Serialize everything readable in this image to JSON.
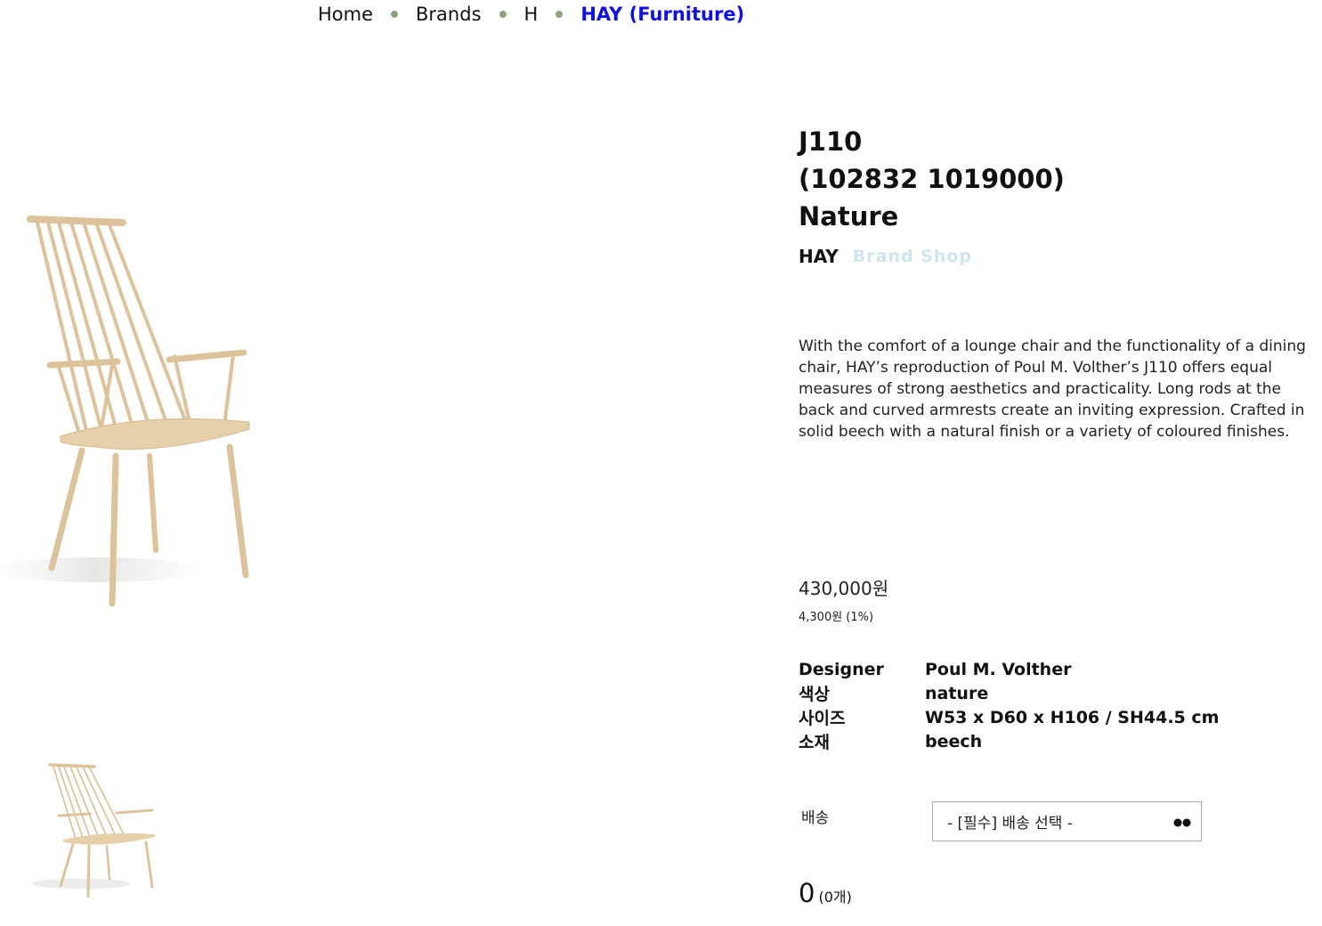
{
  "breadcrumb": {
    "items": [
      "Home",
      "Brands",
      "H"
    ],
    "current": "HAY (Furniture)"
  },
  "product": {
    "name_line1": "J110",
    "name_line2": "(102832 1019000)",
    "name_line3": "Nature",
    "brand": "HAY",
    "brand_shop_label": "Brand Shop",
    "description": "With the comfort of a lounge chair and the functionality of a dining chair, HAY’s reproduction of Poul M. Volther’s J110 offers equal measures of strong aesthetics and practicality. Long rods at the back and curved armrests create an inviting expression. Crafted in solid beech with a natural finish or a variety of coloured finishes.",
    "price": "430,000원",
    "mileage": "4,300원 (1%)"
  },
  "specs": [
    {
      "label": "Designer",
      "value": "Poul M. Volther"
    },
    {
      "label": "색상",
      "value": "nature"
    },
    {
      "label": "사이즈",
      "value": "W53 x D60 x H106 / SH44.5 cm"
    },
    {
      "label": "소재",
      "value": "beech"
    }
  ],
  "shipping": {
    "label": "배송",
    "selected": "- [필수] 배송 선택 -"
  },
  "total": {
    "amount": "0",
    "count": "(0개)"
  },
  "colors": {
    "current_crumb": "#1010e0",
    "crumb_separator": "#8fa37f",
    "brand_shop": "#cde6ee",
    "wood": "#e3c9a1"
  },
  "images": {
    "main": "chair-j110-nature",
    "thumbnail": "chair-j110-nature-thumbnail"
  }
}
